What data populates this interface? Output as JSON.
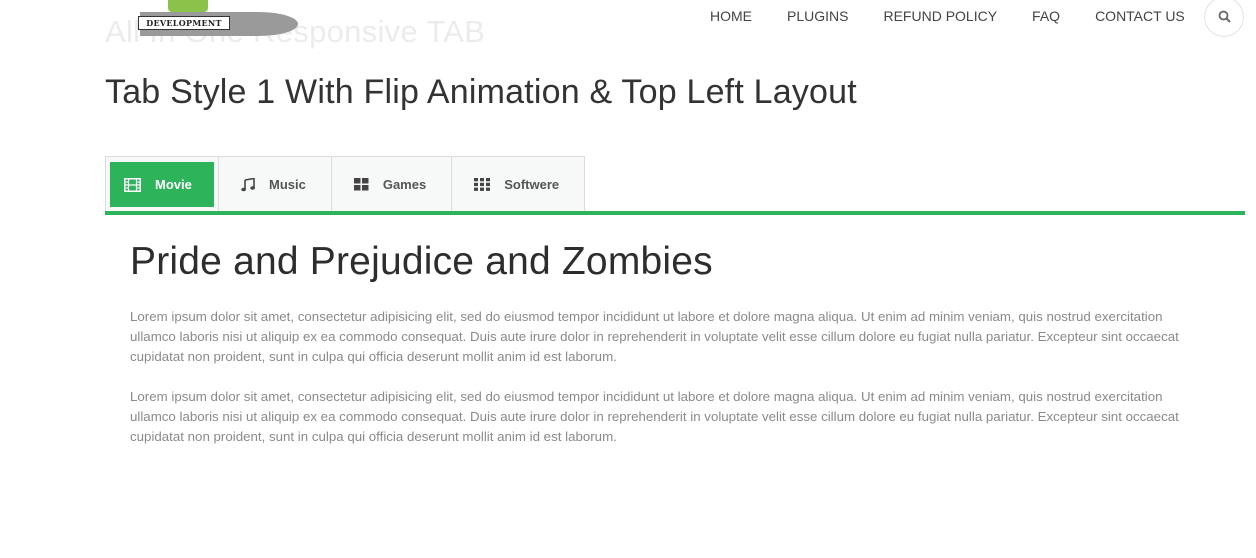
{
  "logo": {
    "band_text": "DEVELOPMENT"
  },
  "page_heading": "All In One Responsive TAB",
  "nav": {
    "items": [
      "HOME",
      "PLUGINS",
      "REFUND POLICY",
      "FAQ",
      "CONTACT US"
    ],
    "search_icon": "search-icon"
  },
  "main_title": "Tab Style 1 With Flip Animation & Top Left Layout",
  "tabs": [
    {
      "label": "Movie",
      "icon": "film-icon",
      "active": true
    },
    {
      "label": "Music",
      "icon": "music-note-icon",
      "active": false
    },
    {
      "label": "Games",
      "icon": "grid-2x2-icon",
      "active": false
    },
    {
      "label": "Softwere",
      "icon": "grid-3x3-icon",
      "active": false
    }
  ],
  "colors": {
    "accent": "#2db35a",
    "logo_green": "#8bc34a",
    "logo_gray": "#9a9a9a"
  },
  "content": {
    "title": "Pride and Prejudice and Zombies",
    "paragraphs": [
      "Lorem ipsum dolor sit amet, consectetur adipisicing elit, sed do eiusmod tempor incididunt ut labore et dolore magna aliqua. Ut enim ad minim veniam, quis nostrud exercitation ullamco laboris nisi ut aliquip ex ea commodo consequat. Duis aute irure dolor in reprehenderit in voluptate velit esse cillum dolore eu fugiat nulla pariatur. Excepteur sint occaecat cupidatat non proident, sunt in culpa qui officia deserunt mollit anim id est laborum.",
      "Lorem ipsum dolor sit amet, consectetur adipisicing elit, sed do eiusmod tempor incididunt ut labore et dolore magna aliqua. Ut enim ad minim veniam, quis nostrud exercitation ullamco laboris nisi ut aliquip ex ea commodo consequat. Duis aute irure dolor in reprehenderit in voluptate velit esse cillum dolore eu fugiat nulla pariatur. Excepteur sint occaecat cupidatat non proident, sunt in culpa qui officia deserunt mollit anim id est laborum."
    ]
  }
}
